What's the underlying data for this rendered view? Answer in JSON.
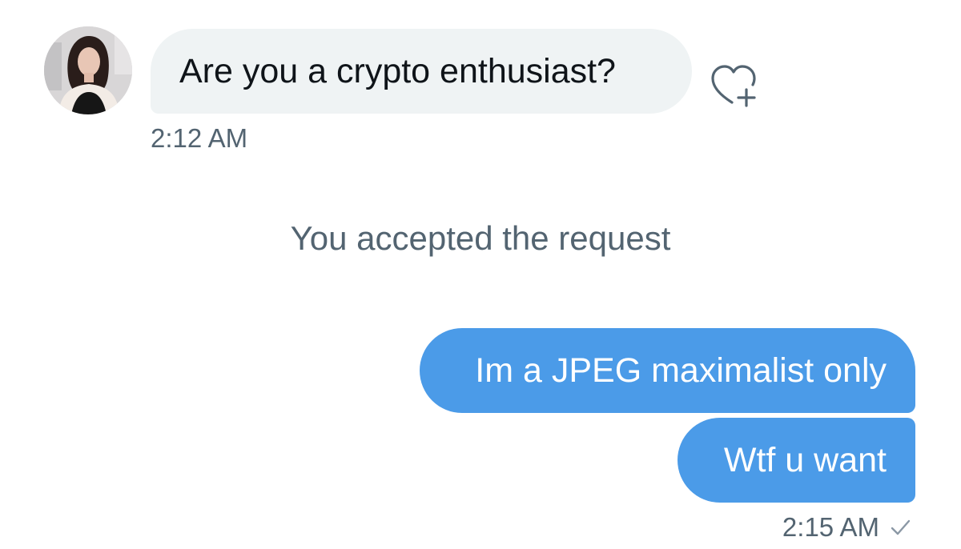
{
  "conversation": {
    "incoming": {
      "avatar_icon": "user-avatar-photo",
      "message": "Are you a crypto enthusiast?",
      "timestamp": "2:12 AM",
      "reaction_icon": "heart-plus-icon"
    },
    "system_message": "You accepted the request",
    "outgoing": {
      "messages": [
        "Im a JPEG maximalist only",
        "Wtf u want"
      ],
      "timestamp": "2:15 AM",
      "status_icon": "sent-check-icon"
    }
  },
  "colors": {
    "outgoing_bubble": "#4b9be8",
    "incoming_bubble": "#eff3f4",
    "secondary_text": "#536471",
    "primary_text": "#0f1419"
  }
}
